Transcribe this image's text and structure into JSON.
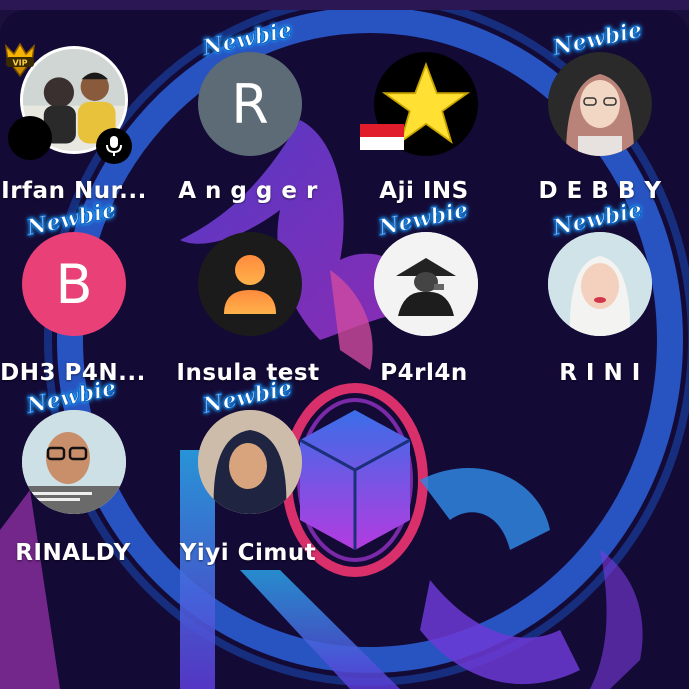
{
  "room": {
    "background_colors": {
      "panel": "#140a36",
      "ring": "#2f6ee8",
      "accent_pink": "#e0307a"
    },
    "seats": [
      {
        "name": "Irfan Nur...",
        "avatar_kind": "photo",
        "badge": "VIP",
        "mic": true,
        "newbie": false
      },
      {
        "name": "A n g g e r",
        "avatar_kind": "letter",
        "letter": "R",
        "avatar_color": "#5c6b76",
        "newbie": true,
        "newbie_label": "Newbie"
      },
      {
        "name": "Aji INS",
        "avatar_kind": "star-icon",
        "flag": "indonesia",
        "newbie": false
      },
      {
        "name": "D E B B Y",
        "avatar_kind": "photo",
        "newbie": true,
        "newbie_label": "Newbie"
      },
      {
        "name": "DH3 P4N...",
        "avatar_kind": "letter",
        "letter": "B",
        "avatar_color": "#e94077",
        "newbie": true,
        "newbie_label": "Newbie"
      },
      {
        "name": "Insula test",
        "avatar_kind": "person-icon",
        "newbie": false
      },
      {
        "name": "P4rl4n",
        "avatar_kind": "photo",
        "newbie": true,
        "newbie_label": "Newbie"
      },
      {
        "name": "R I N I",
        "avatar_kind": "photo",
        "newbie": true,
        "newbie_label": "Newbie"
      },
      {
        "name": "RINALDY",
        "avatar_kind": "photo",
        "newbie": true,
        "newbie_label": "Newbie"
      },
      {
        "name": "Yiyi Cimut",
        "avatar_kind": "photo",
        "newbie": true,
        "newbie_label": "Newbie"
      }
    ]
  }
}
